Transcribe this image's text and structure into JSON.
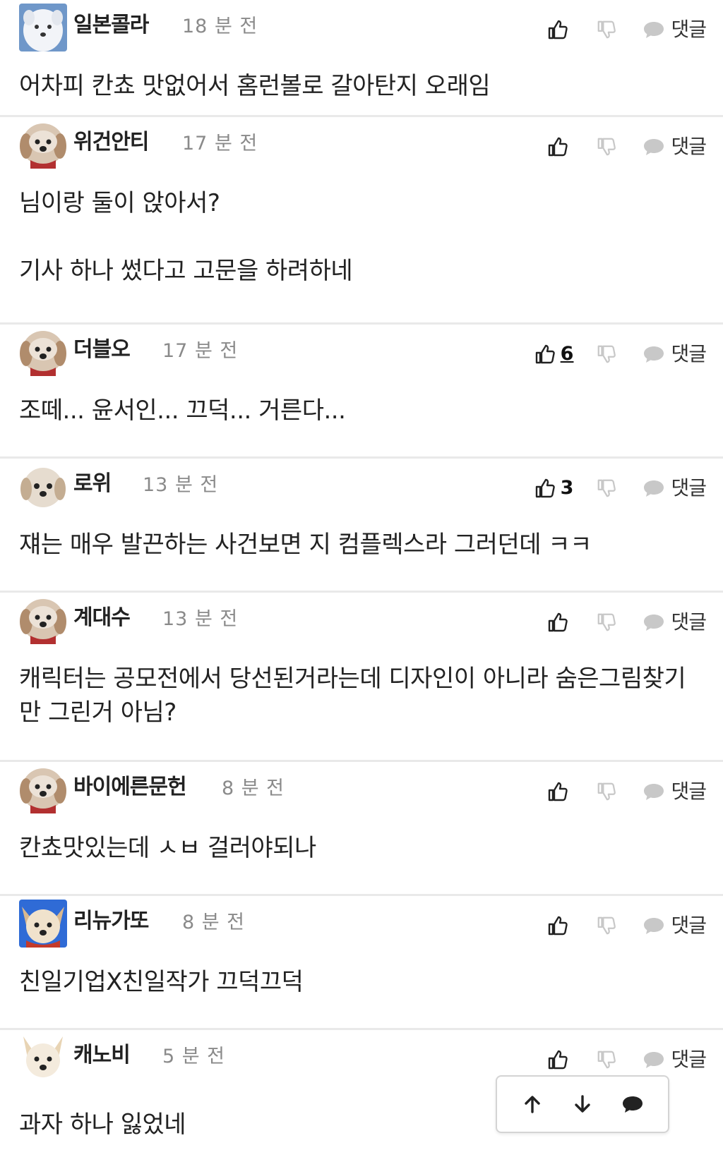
{
  "comments": [
    {
      "nickname": "일본콜라",
      "time": "18 분 전",
      "likes": "",
      "reply_label": "댓글",
      "lines": [
        "어차피 칸쵸 맛없어서 홈런볼로 갈아탄지 오래임"
      ]
    },
    {
      "nickname": "위건안티",
      "time": "17 분 전",
      "likes": "",
      "reply_label": "댓글",
      "lines": [
        "님이랑 둘이 앉아서?",
        "",
        "기사 하나 썼다고 고문을 하려하네"
      ]
    },
    {
      "nickname": "더블오",
      "time": "17 분 전",
      "likes": "6",
      "reply_label": "댓글",
      "lines": [
        "조떼... 윤서인... 끄덕... 거른다..."
      ]
    },
    {
      "nickname": "로위",
      "time": "13 분 전",
      "likes": "3",
      "reply_label": "댓글",
      "lines": [
        "쟤는 매우 발끈하는 사건보면 지 컴플렉스라 그러던데 ㅋㅋ"
      ]
    },
    {
      "nickname": "계대수",
      "time": "13 분 전",
      "likes": "",
      "reply_label": "댓글",
      "lines": [
        "캐릭터는 공모전에서 당선된거라는데 디자인이 아니라 숨은그림찾기만 그린거 아님?"
      ]
    },
    {
      "nickname": "바이에른문헌",
      "time": "8 분 전",
      "likes": "",
      "reply_label": "댓글",
      "lines": [
        "칸쵸맛있는데 ㅅㅂ 걸러야되나"
      ]
    },
    {
      "nickname": "리뉴가또",
      "time": "8 분 전",
      "likes": "",
      "reply_label": "댓글",
      "lines": [
        "친일기업X친일작가 끄덕끄덕"
      ]
    },
    {
      "nickname": "캐노비",
      "time": "5 분 전",
      "likes": "",
      "reply_label": "댓글",
      "lines": [
        "과자 하나 잃었네"
      ]
    }
  ],
  "icons": {
    "like": "thumbs-up-icon",
    "dislike": "thumbs-down-icon",
    "reply": "speech-bubble-icon",
    "scroll_up": "arrow-up-icon",
    "scroll_down": "arrow-down-icon",
    "comment": "speech-bubble-icon"
  },
  "colors": {
    "divider": "#e9e9e9",
    "time_text": "#8a8a8a",
    "icon_gray": "#c8c8c8",
    "icon_dark": "#222222"
  }
}
